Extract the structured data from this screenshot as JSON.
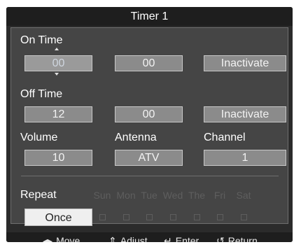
{
  "window": {
    "title": "Timer 1"
  },
  "on_time": {
    "label": "On Time",
    "hour": "00",
    "minute": "00",
    "status": "Inactivate"
  },
  "off_time": {
    "label": "Off Time",
    "hour": "12",
    "minute": "00",
    "status": "Inactivate"
  },
  "settings": {
    "volume_label": "Volume",
    "volume_value": "10",
    "antenna_label": "Antenna",
    "antenna_value": "ATV",
    "channel_label": "Channel",
    "channel_value": "1"
  },
  "repeat": {
    "label": "Repeat",
    "selected": "Once",
    "days": [
      "Sun",
      "Mon",
      "Tue",
      "Wed",
      "The",
      "Fri",
      "Sat"
    ]
  },
  "footer": {
    "move": "Move",
    "adjust": "Adjust",
    "enter": "Enter",
    "return": "Return"
  },
  "icons": {
    "move": "left-right-arrows-icon",
    "adjust": "up-down-arrows-icon",
    "enter": "enter-icon",
    "return": "return-icon"
  },
  "colors": {
    "background": "#2b2b2b",
    "panel": "#454545",
    "field": "#8b8b8b",
    "selected": "#efefef"
  }
}
